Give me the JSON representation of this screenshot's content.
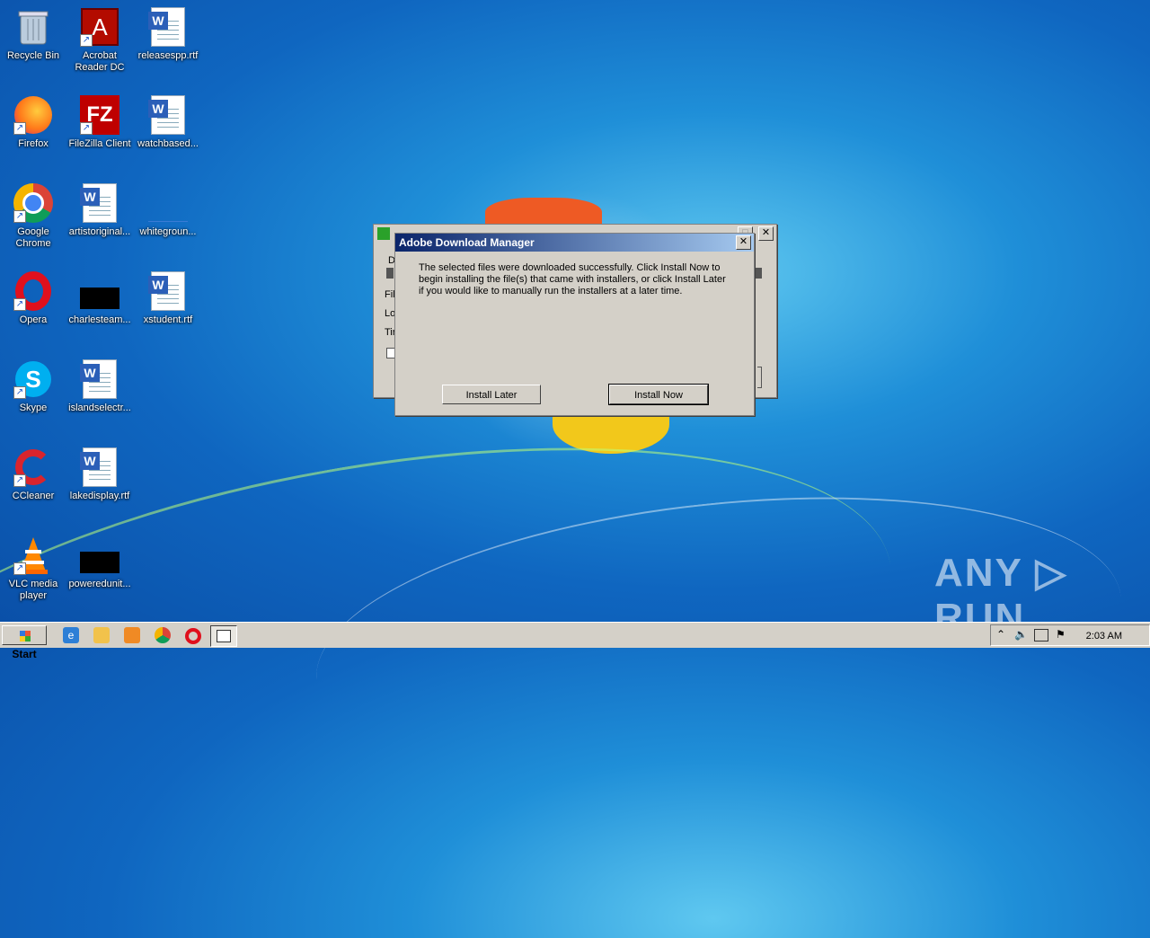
{
  "desktop": {
    "icons": [
      {
        "label": "Recycle Bin"
      },
      {
        "label": "Acrobat Reader DC"
      },
      {
        "label": "releasespp.rtf"
      },
      {
        "label": "Firefox"
      },
      {
        "label": "FileZilla Client"
      },
      {
        "label": "watchbased..."
      },
      {
        "label": "Google Chrome"
      },
      {
        "label": "artistoriginal..."
      },
      {
        "label": "whitegroun..."
      },
      {
        "label": "Opera"
      },
      {
        "label": "charlesteam..."
      },
      {
        "label": "xstudent.rtf"
      },
      {
        "label": "Skype"
      },
      {
        "label": "islandselectr..."
      },
      {
        "label": "CCleaner"
      },
      {
        "label": "lakedisplay.rtf"
      },
      {
        "label": "VLC media player"
      },
      {
        "label": "poweredunit..."
      }
    ]
  },
  "back_dialog": {
    "fragments": [
      "D",
      "Fil",
      "Lo",
      "Tir"
    ]
  },
  "dialog": {
    "title": "Adobe Download Manager",
    "message": "The selected files were downloaded successfully. Click Install Now to begin installing the file(s) that came with installers, or click Install Later if you would like to manually run the installers at a later time.",
    "install_later": "Install Later",
    "install_now": "Install Now",
    "close": "✕"
  },
  "taskbar": {
    "start": "Start",
    "clock": "2:03 AM",
    "tray_expand": "⌃"
  },
  "watermark": "ANY ▷ RUN",
  "colors": {
    "title_start": "#0a246a",
    "title_end": "#a6caf0",
    "chrome": "#d4d0c8"
  }
}
